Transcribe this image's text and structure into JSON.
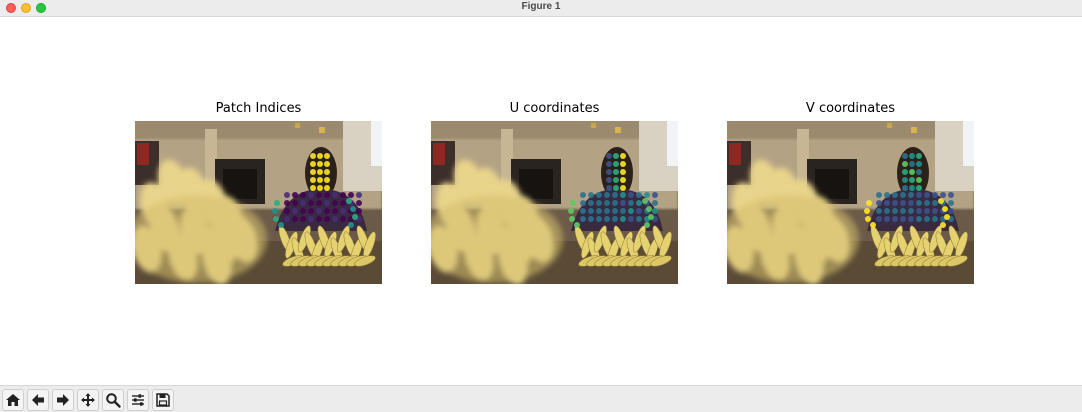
{
  "window": {
    "title": "Figure 1"
  },
  "panels": [
    {
      "title": "Patch Indices",
      "colormap": "viridis"
    },
    {
      "title": "U coordinates",
      "colormap": "viridis"
    },
    {
      "title": "V coordinates",
      "colormap": "viridis"
    }
  ],
  "toolbar": {
    "buttons": [
      {
        "icon": "home-icon",
        "label": "Home"
      },
      {
        "icon": "back-icon",
        "label": "Back"
      },
      {
        "icon": "forward-icon",
        "label": "Forward"
      },
      {
        "icon": "pan-icon",
        "label": "Pan"
      },
      {
        "icon": "zoom-icon",
        "label": "Zoom"
      },
      {
        "icon": "subplots-icon",
        "label": "Configure subplots"
      },
      {
        "icon": "save-icon",
        "label": "Save"
      }
    ]
  },
  "colors": {
    "titlebar": "#ececec",
    "toolbar": "#ececec",
    "viridis_low": "#440154",
    "viridis_mid": "#21918c",
    "viridis_high": "#fde725"
  }
}
